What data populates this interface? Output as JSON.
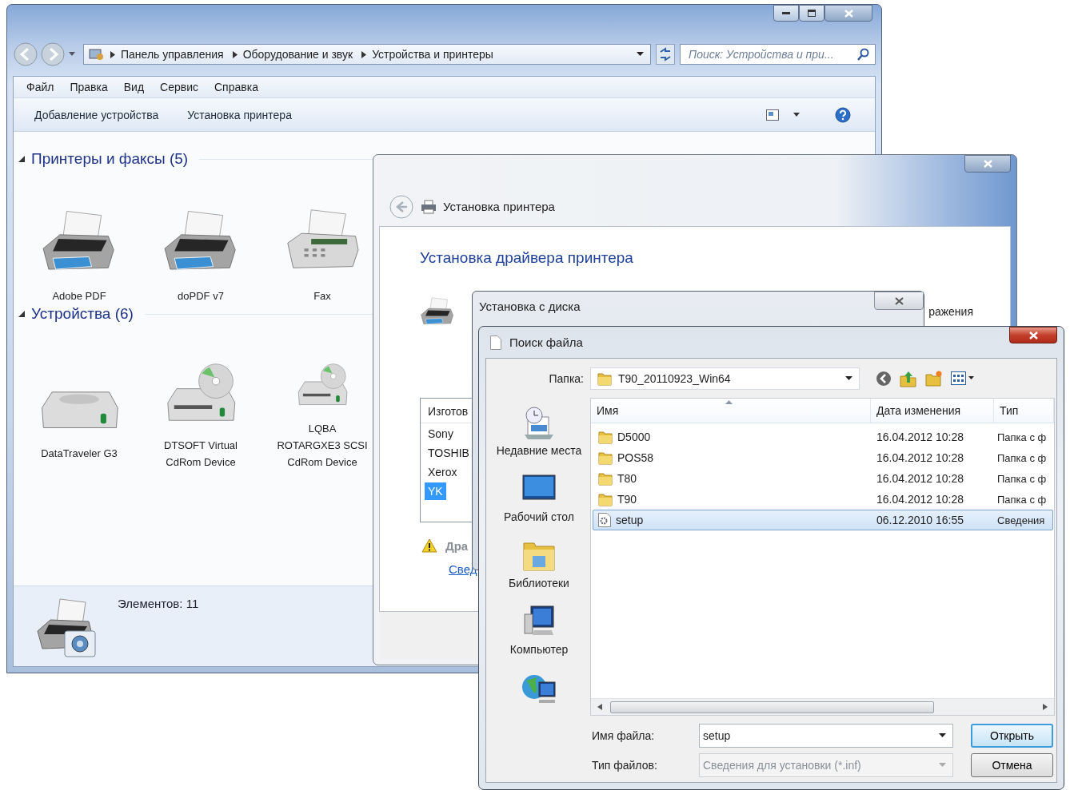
{
  "explorer": {
    "address": {
      "breadcrumbs": [
        "Панель управления",
        "Оборудование и звук",
        "Устройства и принтеры"
      ]
    },
    "search": {
      "placeholder": "Поиск: Устройства и при..."
    },
    "menu": [
      "Файл",
      "Правка",
      "Вид",
      "Сервис",
      "Справка"
    ],
    "commands": [
      "Добавление устройства",
      "Установка принтера"
    ],
    "groups": [
      {
        "title": "Принтеры и факсы (5)",
        "expanded": true,
        "items": [
          {
            "label": "Adobe PDF",
            "kind": "printer"
          },
          {
            "label": "doPDF v7",
            "kind": "printer"
          },
          {
            "label": "Fax",
            "kind": "fax"
          }
        ]
      },
      {
        "title": "Устройства (6)",
        "expanded": true,
        "items": [
          {
            "label": "DataTraveler G3",
            "kind": "drive"
          },
          {
            "label": "DTSOFT Virtual CdRom Device",
            "kind": "cdrom"
          },
          {
            "label": "LQBA ROTARGXE3 SCSI CdRom Device",
            "kind": "cdrom"
          }
        ]
      }
    ],
    "status": "Элементов: 11"
  },
  "wizard": {
    "title": "Установка принтера",
    "heading": "Установка драйвера принтера",
    "text_fragment": "ражения",
    "list": {
      "header": "Изготов",
      "items": [
        {
          "label": "Sony",
          "selected": false
        },
        {
          "label": "TOSHIB",
          "selected": false
        },
        {
          "label": "Xerox",
          "selected": false
        },
        {
          "label": "YK",
          "selected": true
        }
      ]
    },
    "warning": "Дра",
    "link": "Свед"
  },
  "disk_dialog": {
    "title": "Установка с диска"
  },
  "file_dialog": {
    "title": "Поиск файла",
    "folder_label": "Папка:",
    "folder": "T90_20110923_Win64",
    "places": [
      {
        "label": "Недавние места",
        "kind": "recent"
      },
      {
        "label": "Рабочий стол",
        "kind": "desktop"
      },
      {
        "label": "Библиотеки",
        "kind": "libraries"
      },
      {
        "label": "Компьютер",
        "kind": "computer"
      },
      {
        "kind": "network"
      }
    ],
    "columns": [
      "Имя",
      "Дата изменения",
      "Тип"
    ],
    "rows": [
      {
        "kind": "folder",
        "name": "D5000",
        "date": "16.04.2012 10:28",
        "type": "Папка с ф",
        "selected": false
      },
      {
        "kind": "folder",
        "name": "POS58",
        "date": "16.04.2012 10:28",
        "type": "Папка с ф",
        "selected": false
      },
      {
        "kind": "folder",
        "name": "T80",
        "date": "16.04.2012 10:28",
        "type": "Папка с ф",
        "selected": false
      },
      {
        "kind": "folder",
        "name": "T90",
        "date": "16.04.2012 10:28",
        "type": "Папка с ф",
        "selected": false
      },
      {
        "kind": "setup",
        "name": "setup",
        "date": "06.12.2010 16:55",
        "type": "Сведения",
        "selected": true
      }
    ],
    "filename_label": "Имя файла:",
    "filename": "setup",
    "filetype_label": "Тип файлов:",
    "filetype": "Сведения для установки (*.inf)",
    "buttons": [
      {
        "label": "Открыть",
        "default": true
      },
      {
        "label": "Отмена",
        "default": false
      }
    ]
  }
}
